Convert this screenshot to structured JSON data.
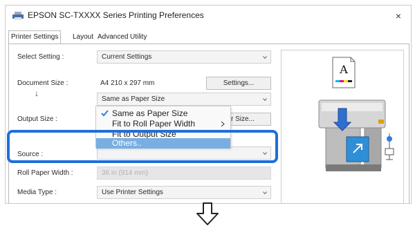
{
  "window": {
    "title": "EPSON SC-TXXXX Series Printing Preferences",
    "close_glyph": "×"
  },
  "tabs": [
    "Printer Settings",
    "Layout",
    "Advanced",
    "Utility"
  ],
  "fields": {
    "select_setting": {
      "label": "Select Setting :",
      "value": "Current Settings"
    },
    "document_size": {
      "label": "Document Size :",
      "value": "A4 210 x 297 mm",
      "button": "Settings..."
    },
    "arrow": "↓",
    "output_select": {
      "value": "Same as Paper Size"
    },
    "output_size": {
      "label": "Output Size :",
      "button_partial": "r Size..."
    },
    "source": {
      "label": "Source :"
    },
    "roll_paper_width": {
      "label": "Roll Paper Width :",
      "value": "36 in (914 mm)"
    },
    "media_type": {
      "label": "Media Type :",
      "value": "Use Printer Settings"
    }
  },
  "dropdown": {
    "items": [
      {
        "label": "Same as Paper Size",
        "checked": true
      },
      {
        "label": "Fit to Roll Paper Width",
        "submenu": true
      },
      {
        "label": "Fit to Output Size"
      },
      {
        "label": "Others..",
        "selected": true
      }
    ]
  },
  "preview": {
    "page_letter": "A"
  },
  "colors": {
    "highlight": "#1e6fd9",
    "selection": "#78aee2",
    "check": "#2f7fd6"
  },
  "next_step_icon": "down-arrow-icon"
}
